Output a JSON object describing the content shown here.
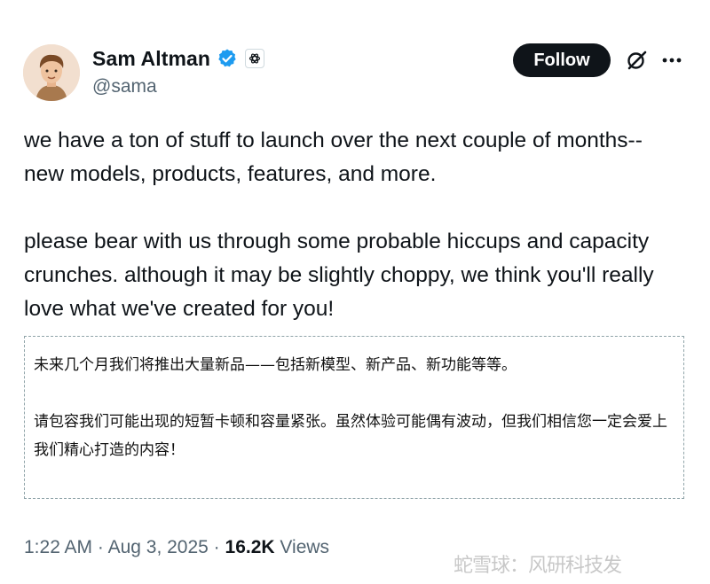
{
  "author": {
    "name": "Sam Altman",
    "handle": "@sama",
    "avatar_icon": "avatar-illustration",
    "verified_icon": "verified-badge-icon",
    "affiliation_icon": "openai-logo-icon"
  },
  "actions": {
    "follow_label": "Follow",
    "grok_icon": "grok-slash-icon",
    "more_icon": "more-dots-icon"
  },
  "tweet": {
    "paragraphs": [
      "we have a ton of stuff to launch over the next couple of months--new models, products, features, and more.",
      "please bear with us through some probable hiccups and capacity crunches. although it may be slightly choppy, we think you'll really love what we've created for you!"
    ]
  },
  "translation": {
    "paragraphs": [
      "未来几个月我们将推出大量新品——包括新模型、新产品、新功能等等。",
      "请包容我们可能出现的短暂卡顿和容量紧张。虽然体验可能偶有波动，但我们相信您一定会爱上我们精心打造的内容！"
    ]
  },
  "meta": {
    "time": "1:22 AM",
    "separator": " · ",
    "date": "Aug 3, 2025",
    "views_count": "16.2K",
    "views_label": "Views"
  },
  "watermark": "蛇雪球：风研科技发",
  "colors": {
    "text": "#0f1419",
    "secondary": "#536471",
    "verified_blue": "#1d9bf0",
    "button_bg": "#0f1419",
    "dashed_border": "#8fa3a8"
  }
}
